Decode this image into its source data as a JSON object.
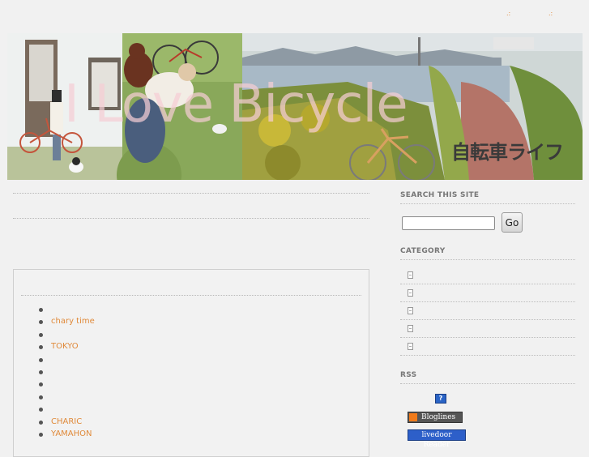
{
  "top_links": [
    ".:",
    ".:"
  ],
  "banner": {
    "title": "I Love Bicycle",
    "subtitle": "自転車ライフ"
  },
  "main": {
    "entries": [
      {
        "label": ""
      },
      {
        "label": "chary time"
      },
      {
        "label": ""
      },
      {
        "label": "TOKYO"
      },
      {
        "label": ""
      },
      {
        "label": ""
      },
      {
        "label": ""
      },
      {
        "label": ""
      },
      {
        "label": ""
      },
      {
        "label": "CHARIC"
      },
      {
        "label": "YAMAHON"
      }
    ]
  },
  "sidebar": {
    "search_heading": "SEARCH THIS SITE",
    "search_value": "",
    "go_label": "Go",
    "category_heading": "CATEGORY",
    "categories": [
      "",
      "",
      "",
      "",
      ""
    ],
    "rss_heading": "RSS",
    "rss_help_icon": "?",
    "bloglines_label": "Bloglines",
    "livedoor_label": "livedoor Reader"
  },
  "colors": {
    "link": "#e08a3a",
    "background": "#f1f1f1",
    "banner_title": "#f5cdd4"
  },
  "icons": [
    "document-icon",
    "help-icon",
    "rss-feed-icon"
  ]
}
